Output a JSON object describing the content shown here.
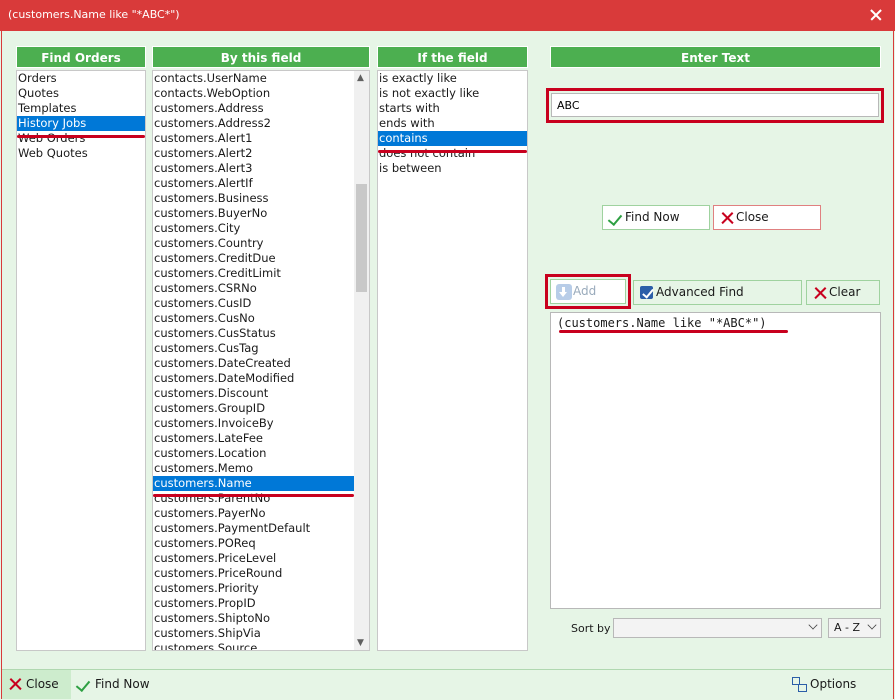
{
  "window": {
    "title": "(customers.Name like \"*ABC*\")"
  },
  "find_orders": {
    "header": "Find Orders",
    "items": [
      "Orders",
      "Quotes",
      "Templates",
      "History Jobs",
      "Web Orders",
      "Web Quotes"
    ],
    "selected": 3
  },
  "by_field": {
    "header": "By this field",
    "items": [
      "contacts.UserName",
      "contacts.WebOption",
      "customers.Address",
      "customers.Address2",
      "customers.Alert1",
      "customers.Alert2",
      "customers.Alert3",
      "customers.AlertIf",
      "customers.Business",
      "customers.BuyerNo",
      "customers.City",
      "customers.Country",
      "customers.CreditDue",
      "customers.CreditLimit",
      "customers.CSRNo",
      "customers.CusID",
      "customers.CusNo",
      "customers.CusStatus",
      "customers.CusTag",
      "customers.DateCreated",
      "customers.DateModified",
      "customers.Discount",
      "customers.GroupID",
      "customers.InvoiceBy",
      "customers.LateFee",
      "customers.Location",
      "customers.Memo",
      "customers.Name",
      "customers.ParentNo",
      "customers.PayerNo",
      "customers.PaymentDefault",
      "customers.POReq",
      "customers.PriceLevel",
      "customers.PriceRound",
      "customers.Priority",
      "customers.PropID",
      "customers.ShiptoNo",
      "customers.ShipVia",
      "customers.Source"
    ],
    "selected": 27
  },
  "if_field": {
    "header": "If the field",
    "items": [
      "is exactly like",
      "is not exactly like",
      "starts with",
      "ends with",
      "contains",
      "does not contain",
      "is between"
    ],
    "selected": 4
  },
  "enter_text": {
    "header": "Enter Text",
    "value": "ABC"
  },
  "buttons": {
    "find_now": "Find Now",
    "close": "Close",
    "add": "Add",
    "advanced_find": "Advanced Find",
    "clear": "Clear"
  },
  "query": {
    "text": "(customers.Name like \"*ABC*\")"
  },
  "sort": {
    "label": "Sort by",
    "field_value": "",
    "order_value": "A - Z"
  },
  "statusbar": {
    "close": "Close",
    "find_now": "Find Now",
    "options": "Options"
  },
  "colors": {
    "accent_green": "#4caf50",
    "title_red": "#d93a3a",
    "highlight_red": "#c8001e",
    "selection_blue": "#0078d7"
  }
}
